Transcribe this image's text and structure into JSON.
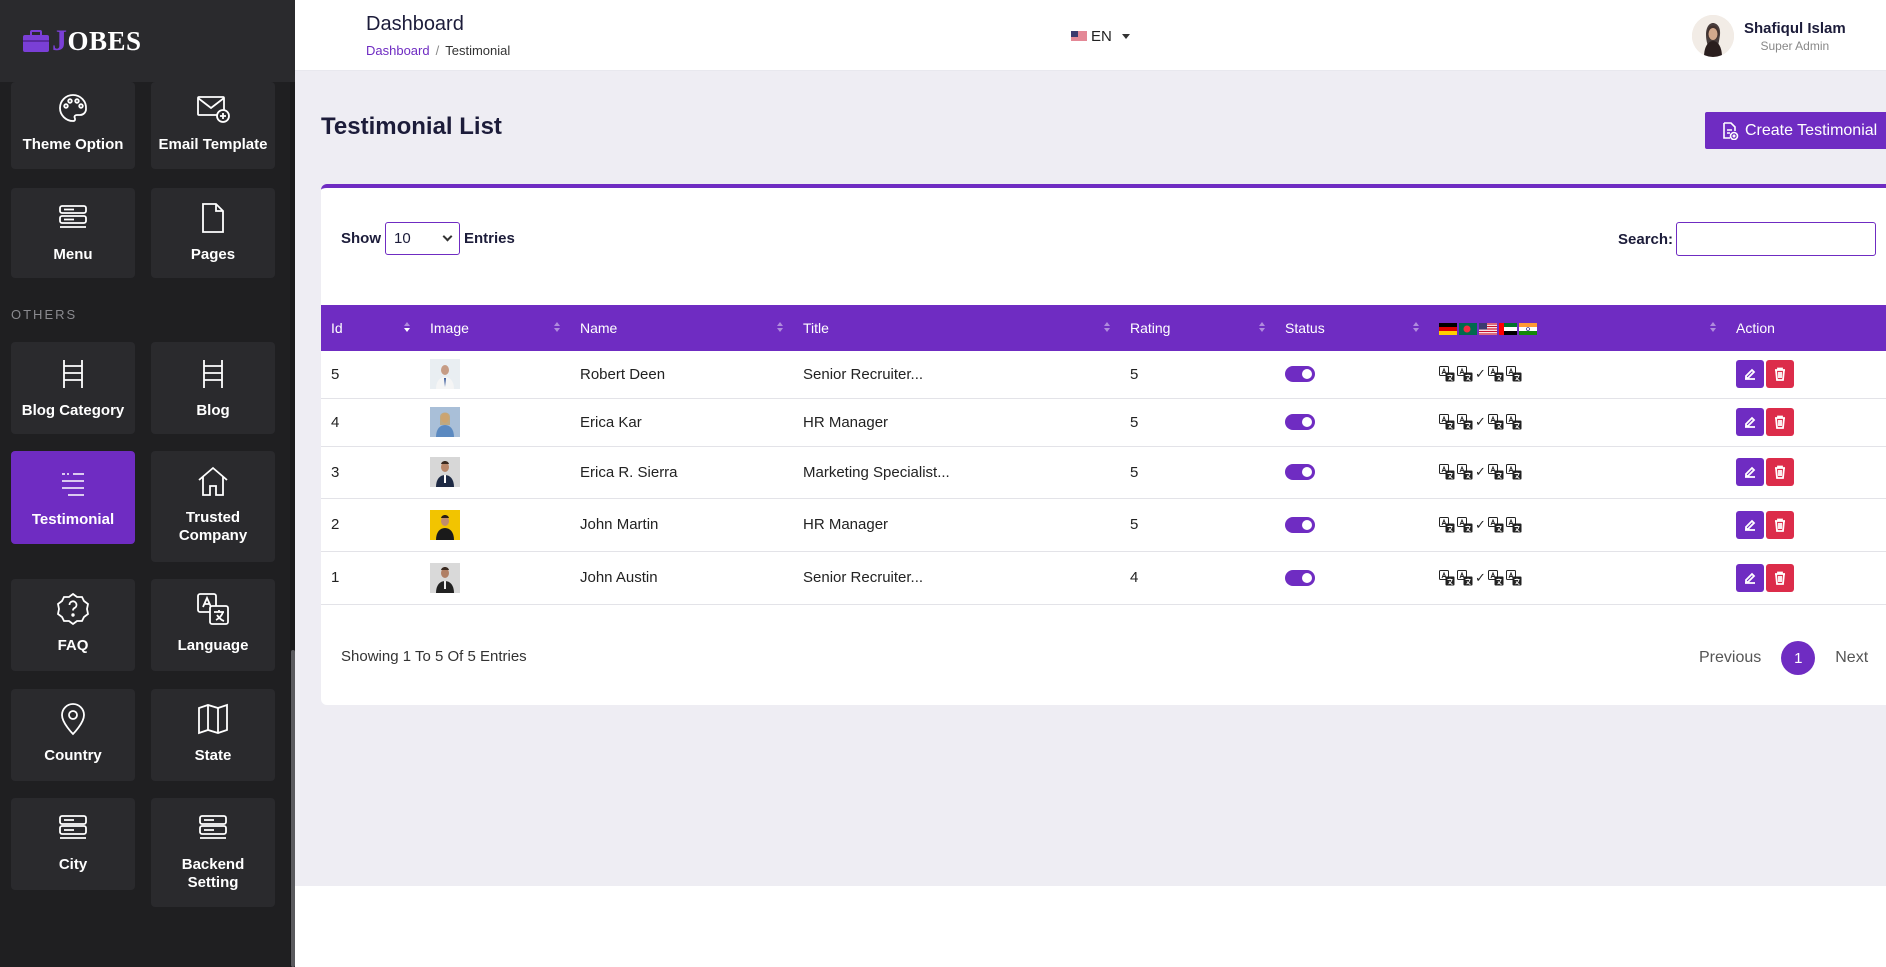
{
  "brand": {
    "name": "OBES",
    "initial": "J"
  },
  "sidebar": {
    "section_others": "OTHERS",
    "tiles": [
      {
        "label": "Theme Option",
        "icon": "palette-icon"
      },
      {
        "label": "Email Template",
        "icon": "email-add-icon"
      },
      {
        "label": "Menu",
        "icon": "menu-icon"
      },
      {
        "label": "Pages",
        "icon": "page-icon"
      },
      {
        "label": "Blog Category",
        "icon": "ladder-icon"
      },
      {
        "label": "Blog",
        "icon": "ladder-icon"
      },
      {
        "label": "Testimonial",
        "icon": "quote-list-icon",
        "active": true
      },
      {
        "label": "Trusted Company",
        "icon": "home-icon"
      },
      {
        "label": "FAQ",
        "icon": "help-icon"
      },
      {
        "label": "Language",
        "icon": "translate-icon"
      },
      {
        "label": "Country",
        "icon": "map-pin-icon"
      },
      {
        "label": "State",
        "icon": "map-icon"
      },
      {
        "label": "City",
        "icon": "server-icon"
      },
      {
        "label": "Backend Setting",
        "icon": "server-icon"
      }
    ]
  },
  "header": {
    "title": "Dashboard",
    "breadcrumb": {
      "home": "Dashboard",
      "current": "Testimonial"
    },
    "language": "EN",
    "user": {
      "name": "Shafiqul Islam",
      "role": "Super Admin"
    }
  },
  "main": {
    "title": "Testimonial List",
    "create_label": "Create Testimonial",
    "show_label": "Show",
    "entries_value": "10",
    "entries_label": "Entries",
    "search_label": "Search:",
    "search_value": "",
    "columns": [
      "Id",
      "Image",
      "Name",
      "Title",
      "Rating",
      "Status",
      "",
      "Action"
    ],
    "rows": [
      {
        "id": "5",
        "name": "Robert Deen",
        "title": "Senior Recruiter...",
        "rating": "5",
        "check": "✓"
      },
      {
        "id": "4",
        "name": "Erica Kar",
        "title": "HR Manager",
        "rating": "5",
        "check": "✓"
      },
      {
        "id": "3",
        "name": "Erica R. Sierra",
        "title": "Marketing Specialist...",
        "rating": "5",
        "check": "✓"
      },
      {
        "id": "2",
        "name": "John Martin",
        "title": "HR Manager",
        "rating": "5",
        "check": "✓"
      },
      {
        "id": "1",
        "name": "John Austin",
        "title": "Senior Recruiter...",
        "rating": "4",
        "check": "✓"
      }
    ],
    "showing_text": "Showing 1 To 5 Of 5 Entries",
    "pager": {
      "prev": "Previous",
      "current": "1",
      "next": "Next"
    }
  },
  "colors": {
    "accent": "#6f2cc2",
    "danger": "#dc2c4a",
    "sidebar_bg": "#1f1f21",
    "tile_bg": "#2a2a2d"
  }
}
